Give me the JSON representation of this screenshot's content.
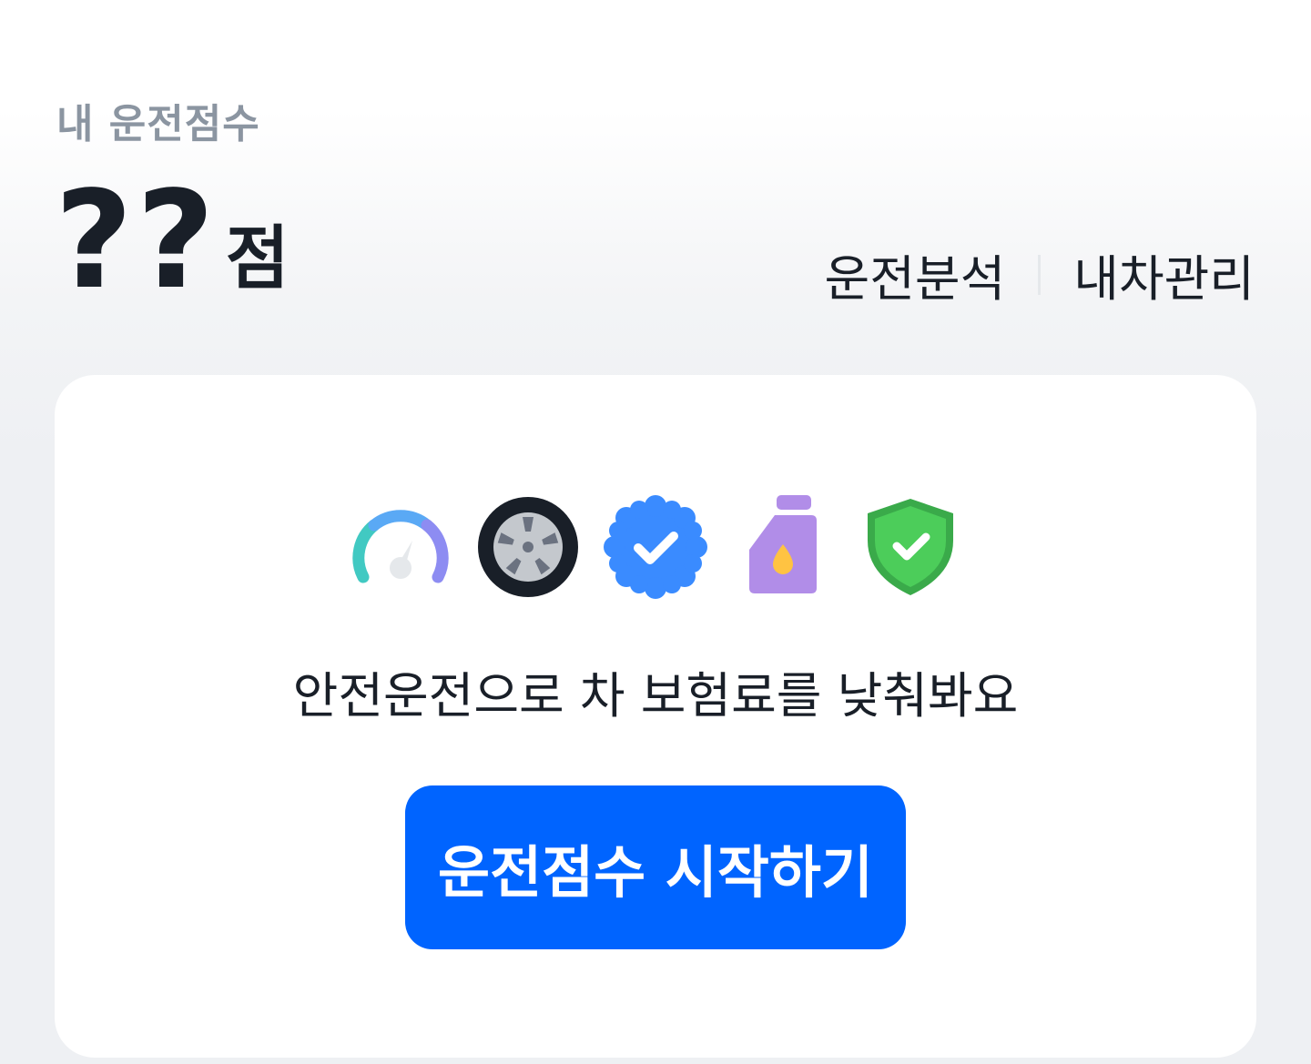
{
  "header": {
    "score_label": "내 운전점수",
    "score_value": "??",
    "score_unit": "점",
    "links": [
      {
        "label": "운전분석"
      },
      {
        "label": "내차관리"
      }
    ]
  },
  "card": {
    "icons": [
      "speedometer-icon",
      "tire-icon",
      "verified-badge-icon",
      "engine-oil-icon",
      "shield-check-icon"
    ],
    "message": "안전운전으로 차 보험료를 낮춰봐요",
    "cta_label": "운전점수 시작하기"
  },
  "colors": {
    "primary": "#0064ff",
    "label_gray": "#8b95a1",
    "text": "#191f28",
    "background": "#eef0f3",
    "card": "#ffffff"
  }
}
